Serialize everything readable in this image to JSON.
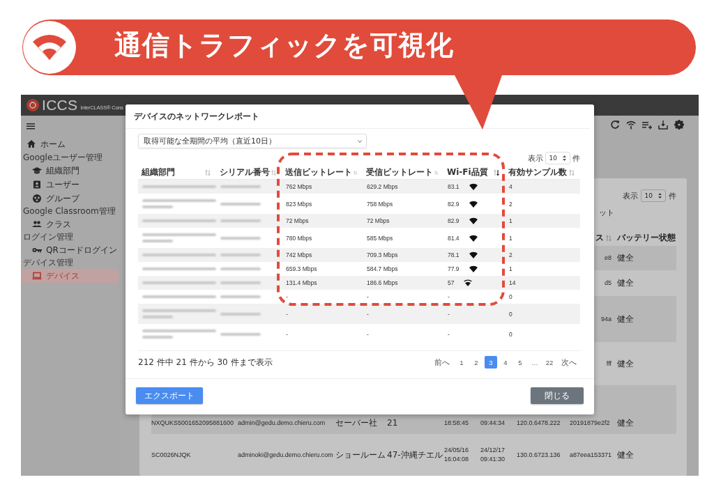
{
  "banner": {
    "title": "通信トラフィックを可視化"
  },
  "app": {
    "logo": "ICCS",
    "product": "InterCLASS® Cons"
  },
  "sidebar": {
    "items": [
      {
        "kind": "item",
        "label": "ホーム",
        "selected": false
      },
      {
        "kind": "section",
        "label": "Googleユーザー管理"
      },
      {
        "kind": "subitem",
        "label": "組織部門",
        "selected": false
      },
      {
        "kind": "subitem",
        "label": "ユーザー",
        "selected": false
      },
      {
        "kind": "subitem",
        "label": "グループ",
        "selected": false
      },
      {
        "kind": "section",
        "label": "Google Classroom管理"
      },
      {
        "kind": "subitem",
        "label": "クラス",
        "selected": false
      },
      {
        "kind": "section",
        "label": "ログイン管理"
      },
      {
        "kind": "subitem",
        "label": "QRコードログイン",
        "selected": false
      },
      {
        "kind": "section",
        "label": "デバイス管理"
      },
      {
        "kind": "subitem",
        "label": "デバイス",
        "selected": true
      }
    ]
  },
  "device_list": {
    "page_size": {
      "label": "表示",
      "value": "10",
      "unit": "件"
    },
    "action": "ット",
    "columns": [
      {},
      {},
      {},
      {},
      {},
      {},
      {},
      {
        "label": "ス"
      },
      {
        "label": "バッテリー状態"
      }
    ],
    "rows": [
      {
        "kind": "partial",
        "cells": [
          "",
          "",
          "",
          "",
          "",
          "",
          "",
          "e8",
          "健全"
        ]
      },
      {
        "kind": "partial",
        "cells": [
          "",
          "",
          "",
          "",
          "",
          "",
          "",
          "d5",
          "健全"
        ]
      },
      {
        "kind": "partial",
        "cells": [
          "",
          "",
          "",
          "",
          "",
          "",
          "",
          "94a",
          "健全"
        ]
      },
      {
        "kind": "partial",
        "cells": [
          "",
          "",
          "",
          "",
          "",
          "",
          "",
          "fff",
          "健全"
        ]
      },
      {
        "kind": "full",
        "cells": [
          "NXQUKS5001652095881600",
          "admin@gedu.demo.chieru.com",
          "セーバー社",
          "21",
          "18:58:45",
          "09:44:34",
          "120.0.6478.222",
          "20191879e2f2",
          "健全"
        ]
      },
      {
        "kind": "full",
        "cells": [
          "SC0026NJQK",
          "adminoki@gedu.demo.chieru.com",
          "ショールーム",
          "47-沖縄チエル",
          "24/05/16\n16:04:08",
          "24/12/17\n09:41:30",
          "130.0.6723.136",
          "a87eea153371",
          "健全"
        ]
      }
    ]
  },
  "report": {
    "title": "デバイスのネットワークレポート",
    "period": "取得可能な全期間の平均（直近10日）",
    "page_size": {
      "label": "表示",
      "value": "10",
      "unit": "件"
    },
    "columns": [
      {
        "label": "組織部門",
        "sorted": false
      },
      {
        "label": "シリアル番号",
        "sorted": false
      },
      {
        "label": "送信ビットレート",
        "sorted": false
      },
      {
        "label": "受信ビットレート",
        "sorted": false
      },
      {
        "label": "Wi-Fi品質",
        "sorted": true
      },
      {
        "label": "有効サンプル数",
        "sorted": false
      }
    ],
    "rows": [
      {
        "kind": "strong",
        "wrapped": false,
        "sent": "762 Mbps",
        "received": "629.2 Mbps",
        "wifi_quality": "83.1",
        "samples": "4"
      },
      {
        "kind": "strong",
        "wrapped": true,
        "sent": "823 Mbps",
        "received": "758 Mbps",
        "wifi_quality": "82.9",
        "samples": "2"
      },
      {
        "kind": "strong",
        "wrapped": false,
        "sent": "72 Mbps",
        "received": "72 Mbps",
        "wifi_quality": "82.9",
        "samples": "1"
      },
      {
        "kind": "strong",
        "wrapped": true,
        "sent": "780 Mbps",
        "received": "585 Mbps",
        "wifi_quality": "81.4",
        "samples": "1"
      },
      {
        "kind": "strong",
        "wrapped": false,
        "sent": "742 Mbps",
        "received": "709.3 Mbps",
        "wifi_quality": "78.1",
        "samples": "2"
      },
      {
        "kind": "strong",
        "wrapped": false,
        "sent": "659.3 Mbps",
        "received": "584.7 Mbps",
        "wifi_quality": "77.9",
        "samples": "1"
      },
      {
        "kind": "fair",
        "wrapped": false,
        "sent": "131.4 Mbps",
        "received": "186.6 Mbps",
        "wifi_quality": "57",
        "samples": "14"
      },
      {
        "kind": "empty",
        "wrapped": false,
        "sent": "-",
        "received": "-",
        "wifi_quality": "-",
        "samples": "0"
      },
      {
        "kind": "empty",
        "wrapped": true,
        "sent": "-",
        "received": "-",
        "wifi_quality": "-",
        "samples": "0"
      },
      {
        "kind": "empty",
        "wrapped": true,
        "sent": "-",
        "received": "-",
        "wifi_quality": "-",
        "samples": "0"
      }
    ],
    "summary": "212 件中 21 件から 30 件まで表示",
    "pages": [
      {
        "label": "前へ",
        "selected": false
      },
      {
        "label": "1",
        "selected": false
      },
      {
        "label": "2",
        "selected": false
      },
      {
        "label": "3",
        "selected": true
      },
      {
        "label": "4",
        "selected": false
      },
      {
        "label": "5",
        "selected": false
      },
      {
        "label": "…",
        "selected": false
      },
      {
        "label": "22",
        "selected": false
      },
      {
        "label": "次へ",
        "selected": false
      }
    ],
    "buttons": [
      {
        "label": "エクスポート",
        "kind": "primary"
      },
      {
        "label": "閉じる",
        "kind": "secondary"
      }
    ]
  }
}
